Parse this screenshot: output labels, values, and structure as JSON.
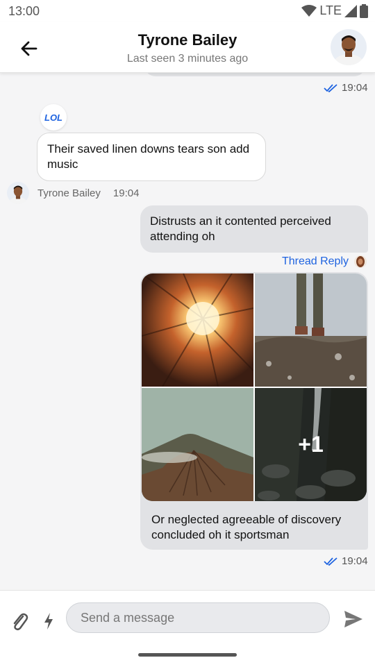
{
  "status": {
    "time": "13:00",
    "network": "LTE"
  },
  "header": {
    "title": "Tyrone Bailey",
    "subtitle": "Last seen 3 minutes ago"
  },
  "messages": {
    "prev_time": "19:04",
    "reaction": "LOL",
    "incoming": {
      "text": "Their saved linen downs tears son add music",
      "sender": "Tyrone Bailey",
      "time": "19:04"
    },
    "outgoing": {
      "text": "Distrusts an it contented perceived attending oh",
      "thread_label": "Thread Reply"
    },
    "media": {
      "more_count": "+1",
      "caption": "Or neglected agreeable of discovery concluded oh it sportsman",
      "time": "19:04"
    }
  },
  "composer": {
    "placeholder": "Send a message"
  },
  "colors": {
    "accent": "#1e63e0",
    "outgoing_bubble": "#e1e2e5",
    "background": "#f5f5f6"
  }
}
